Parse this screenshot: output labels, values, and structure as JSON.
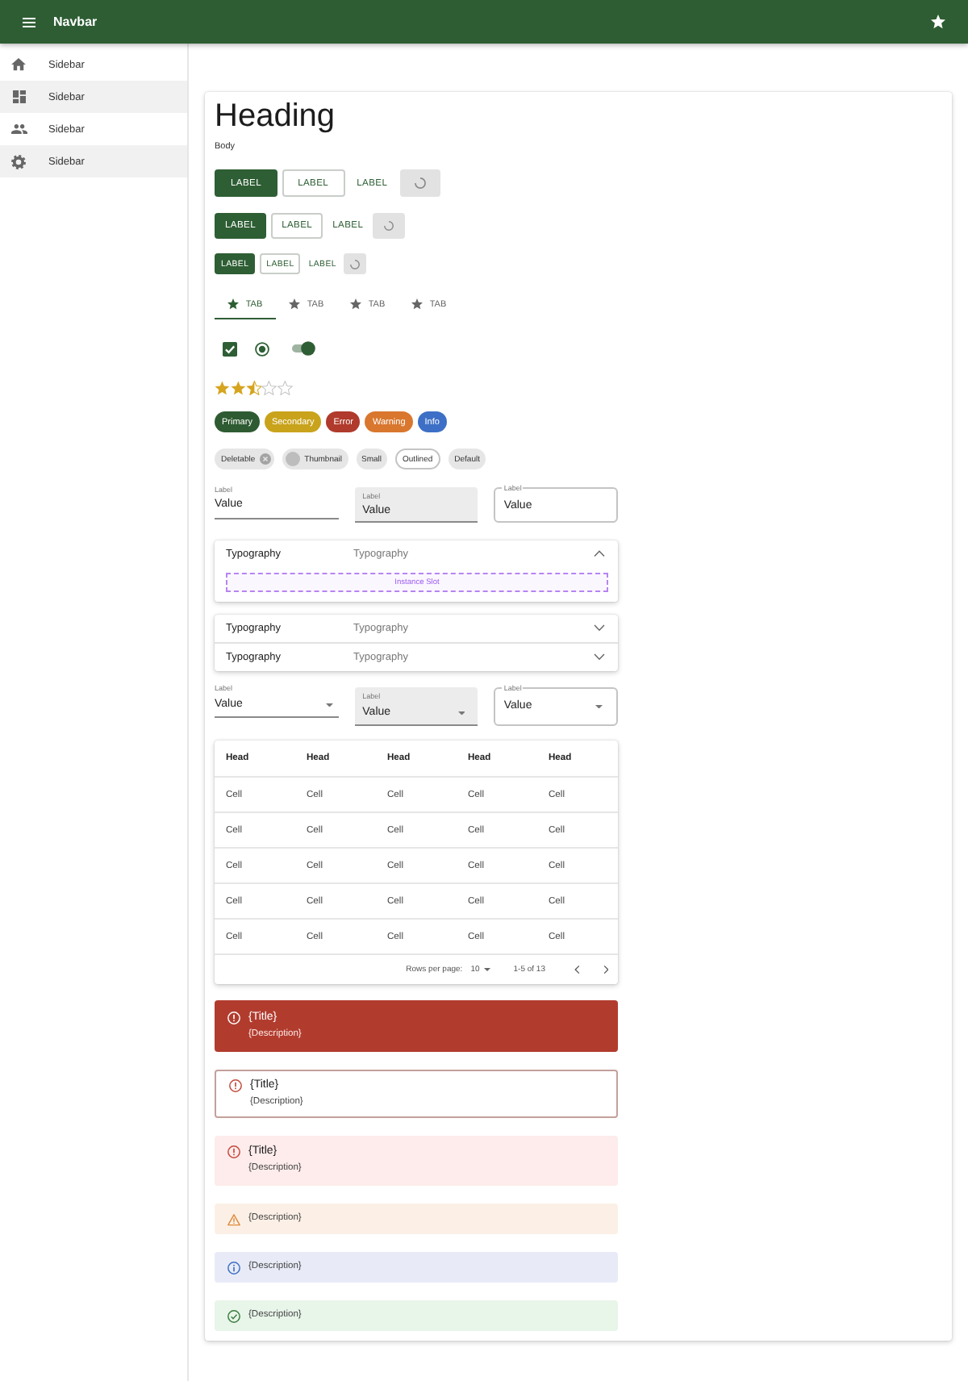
{
  "navbar": {
    "title": "Navbar"
  },
  "sidebar": {
    "items": [
      {
        "label": "Sidebar",
        "selected": false
      },
      {
        "label": "Sidebar",
        "selected": true
      },
      {
        "label": "Sidebar",
        "selected": false
      },
      {
        "label": "Sidebar",
        "selected": true
      }
    ]
  },
  "heading": "Heading",
  "body": "Body",
  "button_rows": [
    {
      "kind": "large",
      "buttons": [
        {
          "kind": "contained",
          "label": "LABEL"
        },
        {
          "kind": "outlined",
          "label": "LABEL"
        },
        {
          "kind": "text",
          "label": "LABEL"
        },
        {
          "kind": "loading"
        }
      ]
    },
    {
      "kind": "medium",
      "buttons": [
        {
          "kind": "contained",
          "label": "LABEL"
        },
        {
          "kind": "outlined",
          "label": "LABEL"
        },
        {
          "kind": "text",
          "label": "LABEL"
        },
        {
          "kind": "loading"
        }
      ]
    },
    {
      "kind": "small",
      "buttons": [
        {
          "kind": "contained",
          "label": "LABEL"
        },
        {
          "kind": "outlined",
          "label": "LABEL"
        },
        {
          "kind": "text",
          "label": "LABEL"
        },
        {
          "kind": "loading"
        }
      ]
    }
  ],
  "tabs": [
    {
      "label": "TAB",
      "selected": true
    },
    {
      "label": "TAB",
      "selected": false
    },
    {
      "label": "TAB",
      "selected": false
    },
    {
      "label": "TAB",
      "selected": false
    }
  ],
  "controls": {
    "checkbox": {
      "checked": true
    },
    "radio": {
      "selected": true
    },
    "switch": {
      "on": true
    }
  },
  "rating": {
    "stars": 2.5
  },
  "color_chips": [
    {
      "label": "Primary",
      "color": "#2e5b31"
    },
    {
      "label": "Secondary",
      "color": "#c9a31b"
    },
    {
      "label": "Error",
      "color": "#b03a2b"
    },
    {
      "label": "Warning",
      "color": "#d9772e"
    },
    {
      "label": "Info",
      "color": "#3d6fc6"
    }
  ],
  "chips": [
    {
      "label": "Deletable",
      "kind": "deletable"
    },
    {
      "label": "Thumbnail",
      "kind": "avatar"
    },
    {
      "label": "Small",
      "kind": "small"
    },
    {
      "label": "Outlined",
      "kind": "outlined"
    },
    {
      "label": "Default",
      "kind": "default"
    }
  ],
  "text_fields": [
    {
      "kind": "standard",
      "label": "Label",
      "value": "Value"
    },
    {
      "kind": "filled",
      "label": "Label",
      "value": "Value"
    },
    {
      "kind": "outlined",
      "label": "Label",
      "value": "Value"
    }
  ],
  "accordion_groups": [
    {
      "items": [
        {
          "title": "Typography",
          "subtitle": "Typography",
          "expanded": true,
          "slot": "Instance Slot"
        }
      ]
    },
    {
      "items": [
        {
          "title": "Typography",
          "subtitle": "Typography",
          "expanded": false
        },
        {
          "title": "Typography",
          "subtitle": "Typography",
          "expanded": false
        }
      ]
    }
  ],
  "select_fields": [
    {
      "kind": "standard",
      "label": "Label",
      "value": "Value"
    },
    {
      "kind": "filled",
      "label": "Label",
      "value": "Value"
    },
    {
      "kind": "outlined",
      "label": "Label",
      "value": "Value"
    }
  ],
  "table": {
    "columns": [
      "Head",
      "Head",
      "Head",
      "Head",
      "Head"
    ],
    "rows": [
      [
        "Cell",
        "Cell",
        "Cell",
        "Cell",
        "Cell"
      ],
      [
        "Cell",
        "Cell",
        "Cell",
        "Cell",
        "Cell"
      ],
      [
        "Cell",
        "Cell",
        "Cell",
        "Cell",
        "Cell"
      ],
      [
        "Cell",
        "Cell",
        "Cell",
        "Cell",
        "Cell"
      ],
      [
        "Cell",
        "Cell",
        "Cell",
        "Cell",
        "Cell"
      ]
    ],
    "pagination": {
      "rows_per_page_label": "Rows per page:",
      "rows_per_page": "10",
      "range": "1-5 of 13"
    }
  },
  "alerts": [
    {
      "kind": "error",
      "filled": true,
      "outlined": false,
      "title": "{Title}",
      "description": "{Description}"
    },
    {
      "kind": "error",
      "filled": false,
      "outlined": true,
      "title": "{Title}",
      "description": "{Description}"
    },
    {
      "kind": "error",
      "filled": false,
      "outlined": false,
      "title": "{Title}",
      "description": "{Description}"
    },
    {
      "kind": "warning",
      "filled": false,
      "outlined": false,
      "description": "{Description}"
    },
    {
      "kind": "info",
      "filled": false,
      "outlined": false,
      "description": "{Description}"
    },
    {
      "kind": "success",
      "filled": false,
      "outlined": false,
      "description": "{Description}"
    }
  ]
}
